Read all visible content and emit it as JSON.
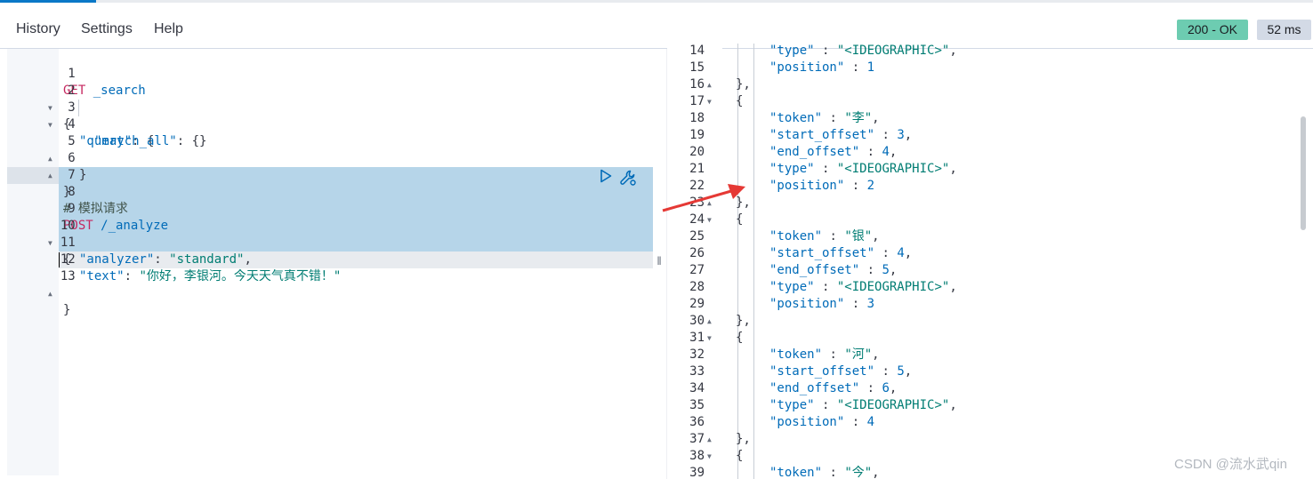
{
  "menu": {
    "history": "History",
    "settings": "Settings",
    "help": "Help"
  },
  "status": {
    "code": "200 - OK",
    "time": "52 ms"
  },
  "request_editor": {
    "line_numbers": [
      "1",
      "2",
      "3",
      "4",
      "5",
      "6",
      "7",
      "8",
      "9",
      "10",
      "11",
      "12",
      "13"
    ],
    "l1_method": "GET",
    "l1_path": " _search",
    "l2": "{",
    "l3_key": "\"query\"",
    "l3_rest": ": {",
    "l4_key": "\"match_all\"",
    "l4_rest": ": {}",
    "l5": "}",
    "l6": "}",
    "l8": "# 模拟请求",
    "l9_method": "POST",
    "l9_path": " /_analyze",
    "l10": "{",
    "l11_key": "\"analyzer\"",
    "l11_sep": ": ",
    "l11_val": "\"standard\"",
    "l11_end": ",",
    "l12_key": "\"text\"",
    "l12_sep": ": ",
    "l12_val": "\"你好，李银河。今天天气真不错！\"",
    "l13": "}"
  },
  "response_editor": {
    "line_numbers": [
      "14",
      "15",
      "16",
      "17",
      "18",
      "19",
      "20",
      "21",
      "22",
      "23",
      "24",
      "25",
      "26",
      "27",
      "28",
      "29",
      "30",
      "31",
      "32",
      "33",
      "34",
      "35",
      "36",
      "37",
      "38",
      "39"
    ],
    "l14_key": "\"type\"",
    "l14_val": "\"<IDEOGRAPHIC>\"",
    "l15_key": "\"position\"",
    "l15_val": "1",
    "l16": "},",
    "l17": "{",
    "l18_key": "\"token\"",
    "l18_val": "\"李\"",
    "l19_key": "\"start_offset\"",
    "l19_val": "3",
    "l20_key": "\"end_offset\"",
    "l20_val": "4",
    "l21_key": "\"type\"",
    "l21_val": "\"<IDEOGRAPHIC>\"",
    "l22_key": "\"position\"",
    "l22_val": "2",
    "l23": "},",
    "l24": "{",
    "l25_key": "\"token\"",
    "l25_val": "\"银\"",
    "l26_key": "\"start_offset\"",
    "l26_val": "4",
    "l27_key": "\"end_offset\"",
    "l27_val": "5",
    "l28_key": "\"type\"",
    "l28_val": "\"<IDEOGRAPHIC>\"",
    "l29_key": "\"position\"",
    "l29_val": "3",
    "l30": "},",
    "l31": "{",
    "l32_key": "\"token\"",
    "l32_val": "\"河\"",
    "l33_key": "\"start_offset\"",
    "l33_val": "5",
    "l34_key": "\"end_offset\"",
    "l34_val": "6",
    "l35_key": "\"type\"",
    "l35_val": "\"<IDEOGRAPHIC>\"",
    "l36_key": "\"position\"",
    "l36_val": "4",
    "l37": "},",
    "l38": "{",
    "l39_key": "\"token\"",
    "l39_val": "\"今\""
  },
  "watermark": "CSDN @流水武qin",
  "colors": {
    "status_ok": "#6dccb1",
    "time_badge": "#d3dae6",
    "selection": "#b6d5e9",
    "keyword": "#c6275f",
    "key": "#006bb8",
    "string": "#017d73",
    "arrow": "#e53935"
  },
  "icons": {
    "run": "play-icon",
    "settings": "wrench-icon",
    "fold_open": "caret-down-icon",
    "fold_close": "caret-up-icon"
  }
}
